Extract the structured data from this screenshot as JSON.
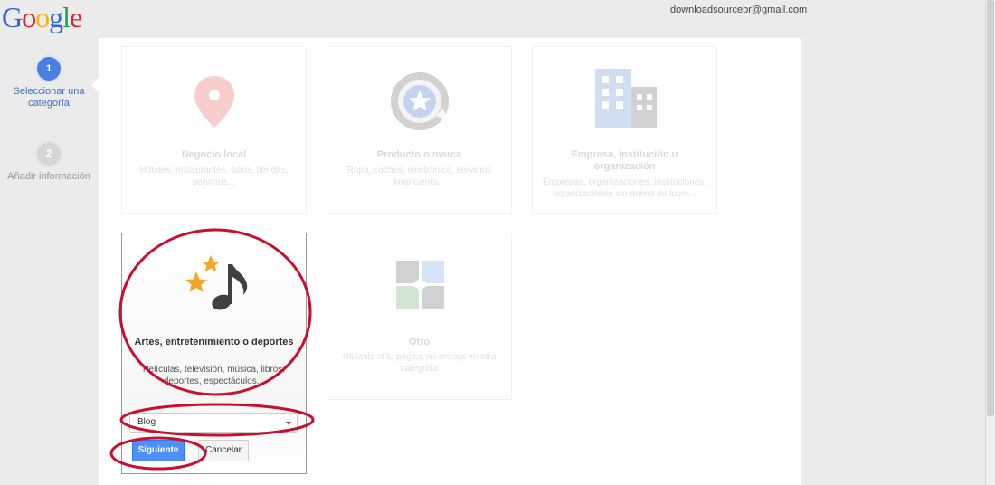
{
  "header": {
    "logo_letters": [
      "G",
      "o",
      "o",
      "g",
      "l",
      "e"
    ],
    "account_email": "downloadsourcebr@gmail.com"
  },
  "steps": [
    {
      "number": "1",
      "label": "Seleccionar una categoría",
      "state": "active"
    },
    {
      "number": "2",
      "label": "Añadir información",
      "state": "inactive"
    }
  ],
  "categories": [
    {
      "id": "local",
      "title": "Negocio local",
      "description": "Hoteles, restaurantes, sitios, tiendas, servicios...",
      "icon": "map-pin-icon"
    },
    {
      "id": "product",
      "title": "Producto o marca",
      "description": "Ropa, coches, electrónica, servicios financieros...",
      "icon": "star-seal-icon"
    },
    {
      "id": "company",
      "title": "Empresa, institución u organización",
      "description": "Empresas, organizaciones, instituciones, organizaciones sin ánimo de lucro...",
      "icon": "building-icon"
    },
    {
      "id": "arts",
      "title": "Artes, entretenimiento o deportes",
      "description": "Películas, televisión, música, libros, deportes, espectáculos...",
      "icon": "music-stars-icon"
    },
    {
      "id": "other",
      "title": "Otro",
      "description": "Utilízala si tu página no encaja en otra categoría",
      "icon": "puzzle-icon"
    }
  ],
  "selected_category": "arts",
  "form": {
    "subcategory_value": "Blog",
    "next_label": "Siguiente",
    "cancel_label": "Cancelar"
  },
  "colors": {
    "accent_blue": "#4d90fe",
    "annotation_red": "#c8102e",
    "google_blue": "#3366cc",
    "google_red": "#d9262c",
    "google_yellow": "#f1b41b",
    "google_green": "#1aa260"
  }
}
